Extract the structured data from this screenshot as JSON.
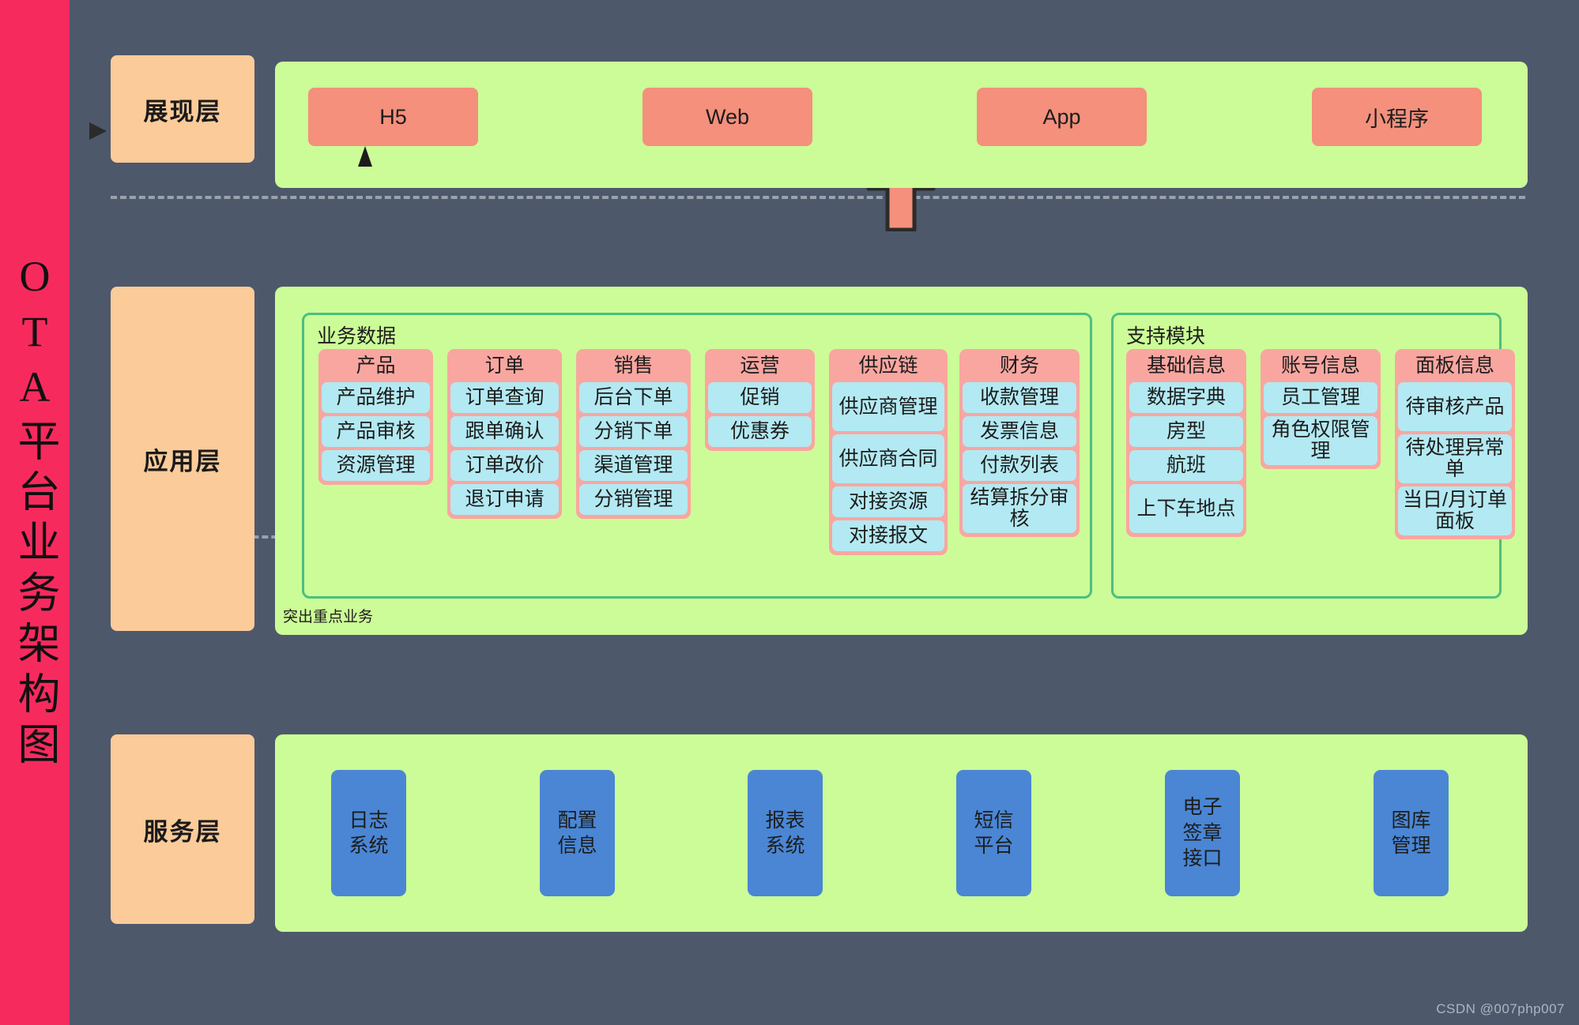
{
  "title_bar": {
    "text": "OTA平台业务架构图",
    "color": "#f72a5e"
  },
  "layers": {
    "presentation": {
      "label": "展现层"
    },
    "application": {
      "label": "应用层"
    },
    "service": {
      "label": "服务层"
    }
  },
  "presentation": {
    "channels": [
      {
        "label": "H5"
      },
      {
        "label": "Web"
      },
      {
        "label": "App"
      },
      {
        "label": "小程序"
      }
    ]
  },
  "application": {
    "note": "突出重点业务",
    "groups": [
      {
        "title": "业务数据",
        "modules": [
          {
            "head": "产品",
            "items": [
              "产品维护",
              "产品审核",
              "资源管理"
            ]
          },
          {
            "head": "订单",
            "items": [
              "订单查询",
              "跟单确认",
              "订单改价",
              "退订申请"
            ]
          },
          {
            "head": "销售",
            "items": [
              "后台下单",
              "分销下单",
              "渠道管理",
              "分销管理"
            ]
          },
          {
            "head": "运营",
            "items": [
              "促销",
              "优惠券"
            ]
          },
          {
            "head": "供应链",
            "items": [
              "供应商管理",
              "供应商合同",
              "对接资源",
              "对接报文"
            ]
          },
          {
            "head": "财务",
            "items": [
              "收款管理",
              "发票信息",
              "付款列表",
              "结算拆分审核"
            ]
          }
        ]
      },
      {
        "title": "支持模块",
        "modules": [
          {
            "head": "基础信息",
            "items": [
              "数据字典",
              "房型",
              "航班",
              "上下车地点"
            ]
          },
          {
            "head": "账号信息",
            "items": [
              "员工管理",
              "角色权限管理"
            ]
          },
          {
            "head": "面板信息",
            "items": [
              "待审核产品",
              "待处理异常单",
              "当日/月订单面板"
            ]
          }
        ]
      }
    ]
  },
  "service": {
    "boxes": [
      {
        "label": "日志\n系统"
      },
      {
        "label": "配置\n信息"
      },
      {
        "label": "报表\n系统"
      },
      {
        "label": "短信\n平台"
      },
      {
        "label": "电子\n签章\n接口"
      },
      {
        "label": "图库\n管理"
      }
    ]
  },
  "watermark": {
    "text": "CSDN @007php007"
  },
  "colors": {
    "background": "#4d586b",
    "title_bar": "#f72a5e",
    "layer_label": "#fbcb99",
    "green_panel": "#ccfc97",
    "channel_box": "#f4907c",
    "module_card": "#f9a6a0",
    "module_item": "#b3e9f2",
    "service_box": "#4a86d4",
    "group_border": "#4cbf7e",
    "arrow_fill": "#f4907c",
    "arrow_stroke": "#2b2b2b",
    "dashed_line": "#9aa1ad"
  }
}
